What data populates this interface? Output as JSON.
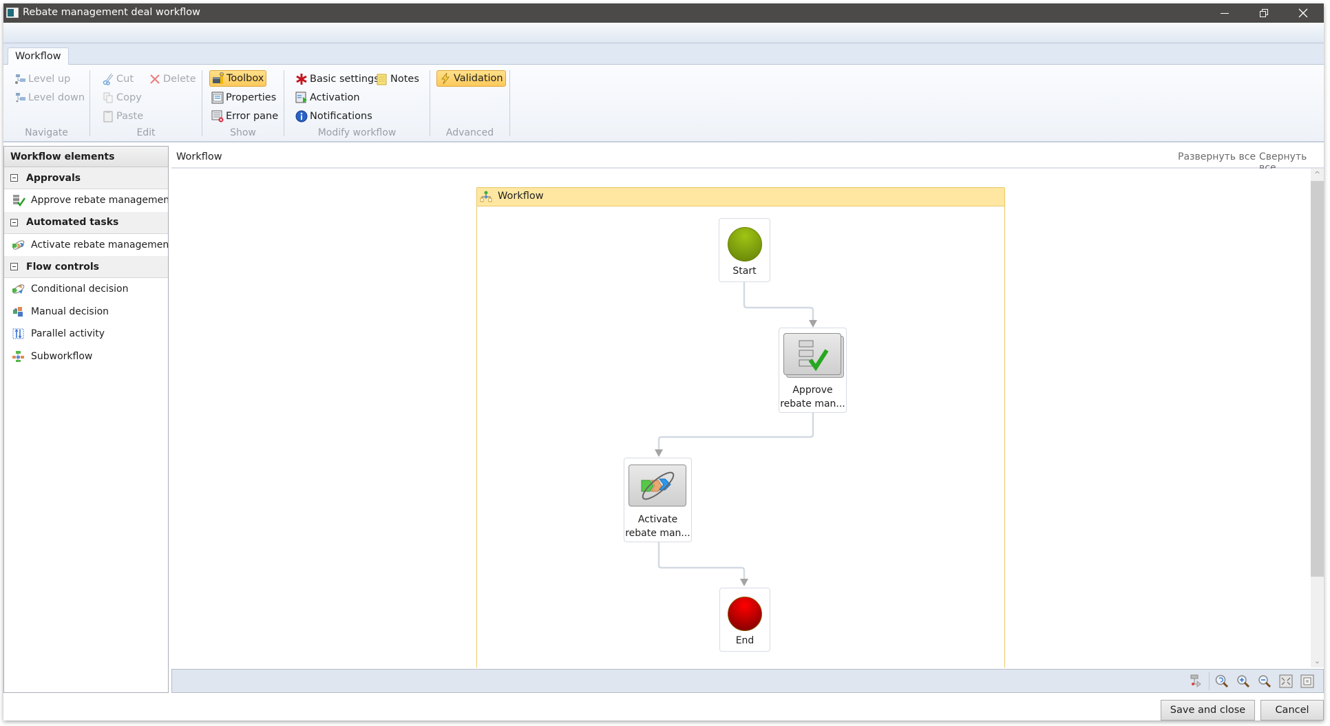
{
  "window": {
    "title": "Rebate management deal workflow",
    "controls": {
      "minimize": "—",
      "restore": "❐",
      "close": "✕"
    }
  },
  "ribbon": {
    "tab": "Workflow",
    "groups": {
      "navigate": {
        "label": "Navigate",
        "level_up": "Level up",
        "level_down": "Level down"
      },
      "edit": {
        "label": "Edit",
        "cut": "Cut",
        "delete": "Delete",
        "copy": "Copy",
        "paste": "Paste"
      },
      "show": {
        "label": "Show",
        "toolbox": "Toolbox",
        "properties": "Properties",
        "error_pane": "Error pane"
      },
      "modify": {
        "label": "Modify workflow",
        "basic_settings": "Basic settings",
        "notes": "Notes",
        "activation": "Activation",
        "notifications": "Notifications"
      },
      "advanced": {
        "label": "Advanced",
        "validation": "Validation"
      }
    }
  },
  "left_panel": {
    "title": "Workflow elements",
    "groups": [
      {
        "label": "Approvals",
        "items": [
          {
            "label": "Approve rebate management",
            "icon": "approval-icon"
          }
        ]
      },
      {
        "label": "Automated tasks",
        "items": [
          {
            "label": "Activate rebate management d",
            "icon": "automated-task-icon"
          }
        ]
      },
      {
        "label": "Flow controls",
        "items": [
          {
            "label": "Conditional decision",
            "icon": "conditional-decision-icon"
          },
          {
            "label": "Manual decision",
            "icon": "manual-decision-icon"
          },
          {
            "label": "Parallel activity",
            "icon": "parallel-activity-icon"
          },
          {
            "label": "Subworkflow",
            "icon": "subworkflow-icon"
          }
        ]
      }
    ]
  },
  "canvas": {
    "breadcrumb": "Workflow",
    "expand_all": "Развернуть все",
    "collapse_all": "Свернуть все",
    "container_title": "Workflow",
    "nodes": {
      "start": {
        "label": "Start",
        "color": "#8aad0f"
      },
      "approve": {
        "line1": "Approve",
        "line2": "rebate man..."
      },
      "activate": {
        "line1": "Activate",
        "line2": "rebate man..."
      },
      "end": {
        "label": "End",
        "color": "#e00000"
      }
    }
  },
  "footer": {
    "save_close": "Save and close",
    "cancel": "Cancel"
  },
  "colors": {
    "titlebar": "#4b4a48",
    "active_button": "#fcc95c",
    "container_header": "#ffe7a1",
    "connector": "#d3d9e3",
    "arrow": "#a0a0a0"
  }
}
